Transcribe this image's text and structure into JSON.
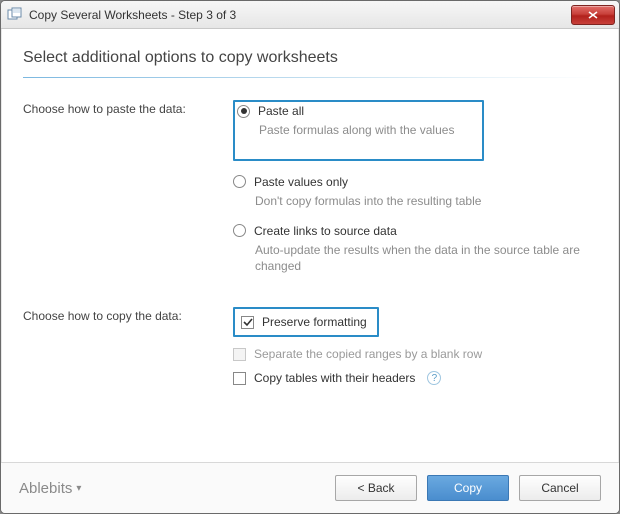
{
  "window": {
    "title": "Copy Several Worksheets - Step 3 of 3"
  },
  "heading": "Select additional options to copy worksheets",
  "paste_section": {
    "label": "Choose how to paste the data:",
    "options": {
      "paste_all": {
        "label": "Paste all",
        "desc": "Paste formulas along with the values"
      },
      "values_only": {
        "label": "Paste values only",
        "desc": "Don't copy formulas into the resulting table"
      },
      "create_links": {
        "label": "Create links to source data",
        "desc": "Auto-update the results when the data in the source table are changed"
      }
    }
  },
  "copy_section": {
    "label": "Choose how to copy the data:",
    "options": {
      "preserve": "Preserve formatting",
      "separate": "Separate the copied ranges by a blank row",
      "headers": "Copy tables with their headers"
    }
  },
  "footer": {
    "brand": "Ablebits",
    "back": "< Back",
    "copy": "Copy",
    "cancel": "Cancel"
  }
}
